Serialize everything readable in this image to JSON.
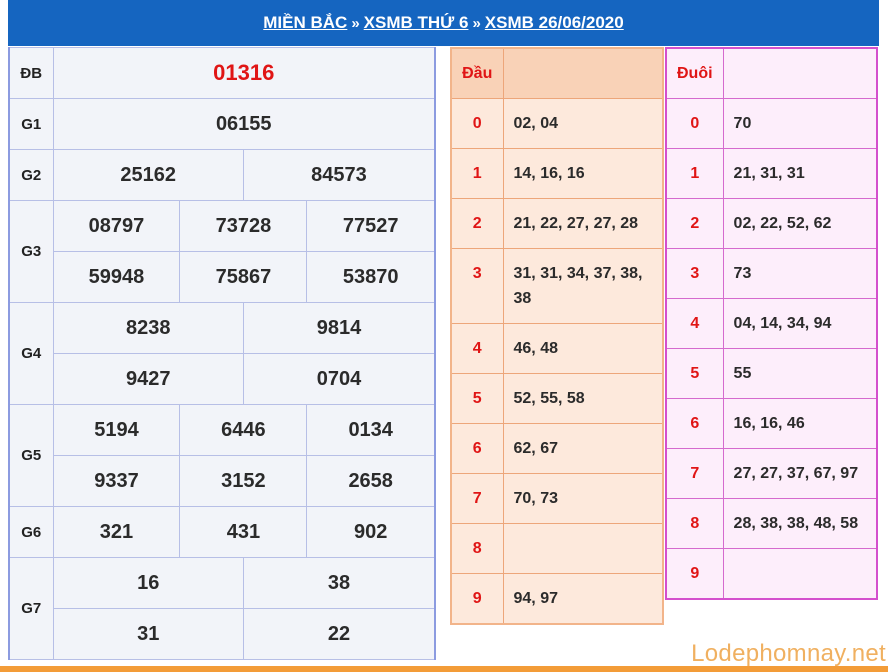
{
  "header": {
    "crumbs": [
      "MIỀN BẮC",
      "XSMB THỨ 6",
      "XSMB 26/06/2020"
    ],
    "separator": "»"
  },
  "results": {
    "db": {
      "label": "ĐB",
      "values": [
        "01316"
      ]
    },
    "g1": {
      "label": "G1",
      "values": [
        "06155"
      ]
    },
    "g2": {
      "label": "G2",
      "values": [
        "25162",
        "84573"
      ]
    },
    "g3": {
      "label": "G3",
      "values": [
        "08797",
        "73728",
        "77527",
        "59948",
        "75867",
        "53870"
      ]
    },
    "g4": {
      "label": "G4",
      "values": [
        "8238",
        "9814",
        "9427",
        "0704"
      ]
    },
    "g5": {
      "label": "G5",
      "values": [
        "5194",
        "6446",
        "0134",
        "9337",
        "3152",
        "2658"
      ]
    },
    "g6": {
      "label": "G6",
      "values": [
        "321",
        "431",
        "902"
      ]
    },
    "g7": {
      "label": "G7",
      "values": [
        "16",
        "38",
        "31",
        "22"
      ]
    }
  },
  "dau": {
    "header": "Đầu",
    "rows": [
      {
        "key": "0",
        "value": "02, 04"
      },
      {
        "key": "1",
        "value": "14, 16, 16"
      },
      {
        "key": "2",
        "value": "21, 22, 27, 27, 28"
      },
      {
        "key": "3",
        "value": "31, 31, 34, 37, 38, 38"
      },
      {
        "key": "4",
        "value": "46, 48"
      },
      {
        "key": "5",
        "value": "52, 55, 58"
      },
      {
        "key": "6",
        "value": "62, 67"
      },
      {
        "key": "7",
        "value": "70, 73"
      },
      {
        "key": "8",
        "value": ""
      },
      {
        "key": "9",
        "value": "94, 97"
      }
    ]
  },
  "duoi": {
    "header": "Đuôi",
    "rows": [
      {
        "key": "0",
        "value": "70"
      },
      {
        "key": "1",
        "value": "21, 31, 31"
      },
      {
        "key": "2",
        "value": "02, 22, 52, 62"
      },
      {
        "key": "3",
        "value": "73"
      },
      {
        "key": "4",
        "value": "04, 14, 34, 94"
      },
      {
        "key": "5",
        "value": "55"
      },
      {
        "key": "6",
        "value": "16, 16, 46"
      },
      {
        "key": "7",
        "value": "27, 27, 37, 67, 97"
      },
      {
        "key": "8",
        "value": "28, 38, 38, 48, 58"
      },
      {
        "key": "9",
        "value": ""
      }
    ]
  },
  "watermark": "Lodephomnay.net",
  "colors": {
    "header_bg": "#1565c0",
    "special_prize": "#e01515",
    "accent_orange": "#f39c38"
  }
}
